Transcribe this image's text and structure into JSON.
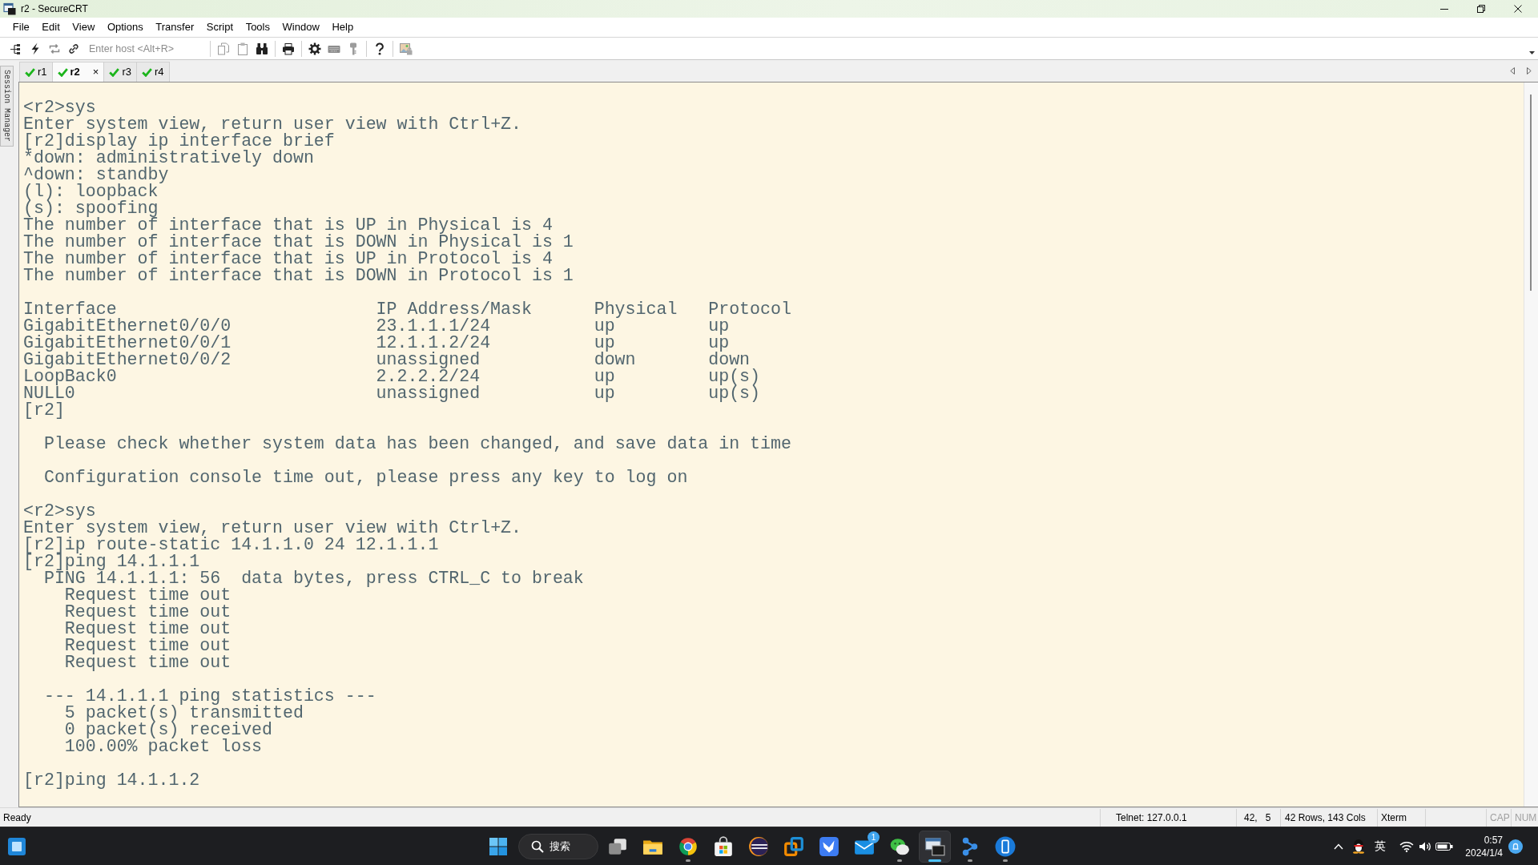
{
  "window": {
    "title": "r2 - SecureCRT"
  },
  "menu": [
    "File",
    "Edit",
    "View",
    "Options",
    "Transfer",
    "Script",
    "Tools",
    "Window",
    "Help"
  ],
  "toolbar": {
    "host_field": {
      "placeholder": "Enter host <Alt+R>"
    }
  },
  "side_panel": {
    "label": "Session Manager"
  },
  "tabs": [
    {
      "label": "r1",
      "connected": true,
      "selected": false
    },
    {
      "label": "r2",
      "connected": true,
      "selected": true,
      "close": "×"
    },
    {
      "label": "r3",
      "connected": true,
      "selected": false
    },
    {
      "label": "r4",
      "connected": true,
      "selected": false
    }
  ],
  "terminal": {
    "entries": [
      {
        "kind": "blank"
      },
      {
        "kind": "text",
        "text": "<r2>sys"
      },
      {
        "kind": "text",
        "text": "Enter system view, return user view with Ctrl+Z."
      },
      {
        "kind": "text",
        "text": "[r2]display ip interface brief"
      },
      {
        "kind": "text",
        "text": "*down: administratively down"
      },
      {
        "kind": "text",
        "text": "^down: standby"
      },
      {
        "kind": "text",
        "text": "(l): loopback"
      },
      {
        "kind": "text",
        "text": "(s): spoofing"
      },
      {
        "kind": "text",
        "text": "The number of interface that is UP in Physical is 4"
      },
      {
        "kind": "text",
        "text": "The number of interface that is DOWN in Physical is 1"
      },
      {
        "kind": "text",
        "text": "The number of interface that is UP in Protocol is 4"
      },
      {
        "kind": "text",
        "text": "The number of interface that is DOWN in Protocol is 1"
      },
      {
        "kind": "blank"
      },
      {
        "kind": "table",
        "columns": [
          "Interface",
          "IP Address/Mask",
          "Physical",
          "Protocol"
        ],
        "rows": [
          [
            "GigabitEthernet0/0/0",
            "23.1.1.1/24",
            "up",
            "up"
          ],
          [
            "GigabitEthernet0/0/1",
            "12.1.1.2/24",
            "up",
            "up"
          ],
          [
            "GigabitEthernet0/0/2",
            "unassigned",
            "down",
            "down"
          ],
          [
            "LoopBack0",
            "2.2.2.2/24",
            "up",
            "up(s)"
          ],
          [
            "NULL0",
            "unassigned",
            "up",
            "up(s)"
          ]
        ]
      },
      {
        "kind": "text",
        "text": "[r2]"
      },
      {
        "kind": "blank"
      },
      {
        "kind": "text",
        "text": "  Please check whether system data has been changed, and save data in time"
      },
      {
        "kind": "blank"
      },
      {
        "kind": "text",
        "text": "  Configuration console time out, please press any key to log on"
      },
      {
        "kind": "blank"
      },
      {
        "kind": "text",
        "text": "<r2>sys"
      },
      {
        "kind": "text",
        "text": "Enter system view, return user view with Ctrl+Z."
      },
      {
        "kind": "text",
        "text": "[r2]ip route-static 14.1.1.0 24 12.1.1.1"
      },
      {
        "kind": "text",
        "text": "[r2]ping 14.1.1.1"
      },
      {
        "kind": "text",
        "text": "  PING 14.1.1.1: 56  data bytes, press CTRL_C to break"
      },
      {
        "kind": "text",
        "text": "    Request time out"
      },
      {
        "kind": "text",
        "text": "    Request time out"
      },
      {
        "kind": "text",
        "text": "    Request time out"
      },
      {
        "kind": "text",
        "text": "    Request time out"
      },
      {
        "kind": "text",
        "text": "    Request time out"
      },
      {
        "kind": "blank"
      },
      {
        "kind": "text",
        "text": "  --- 14.1.1.1 ping statistics ---"
      },
      {
        "kind": "text",
        "text": "    5 packet(s) transmitted"
      },
      {
        "kind": "text",
        "text": "    0 packet(s) received"
      },
      {
        "kind": "text",
        "text": "    100.00% packet loss"
      },
      {
        "kind": "blank"
      },
      {
        "kind": "text",
        "text": "[r2]ping 14.1.1.2"
      }
    ]
  },
  "status_bar": {
    "message": "Ready",
    "cells": [
      "Telnet: 127.0.0.1",
      "42,   5",
      "42 Rows, 143 Cols",
      "Xterm"
    ],
    "indicators": [
      {
        "label": "CAP",
        "on": false
      },
      {
        "label": "NUM",
        "on": false
      }
    ]
  },
  "taskbar": {
    "search": {
      "label": "搜索"
    },
    "apps": [
      {
        "kind": "taskview",
        "running": false,
        "selected": false
      },
      {
        "kind": "folder",
        "running": false,
        "selected": false
      },
      {
        "kind": "browser",
        "running": true,
        "selected": false
      },
      {
        "kind": "store",
        "running": false,
        "selected": false
      },
      {
        "kind": "ide",
        "running": false,
        "selected": false
      },
      {
        "kind": "vm",
        "running": false,
        "selected": false
      },
      {
        "kind": "bird",
        "running": false,
        "selected": false
      },
      {
        "kind": "mail",
        "running": false,
        "selected": false,
        "badge": "1"
      },
      {
        "kind": "chat",
        "running": true,
        "selected": false
      },
      {
        "kind": "terminal",
        "running": true,
        "selected": true
      },
      {
        "kind": "network",
        "running": true,
        "selected": false
      },
      {
        "kind": "phone",
        "running": true,
        "selected": false
      }
    ],
    "tray": {
      "input_method": "英",
      "time": "0:57",
      "date": "2024/1/4"
    }
  }
}
